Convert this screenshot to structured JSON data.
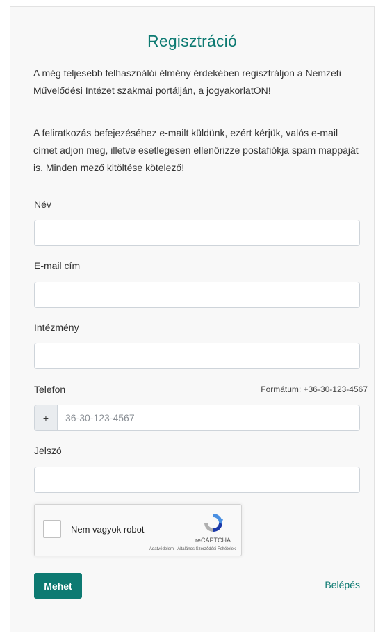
{
  "form": {
    "title": "Regisztráció",
    "intro": "A még teljesebb felhasználói élmény érdekében regisztráljon a Nemzeti Művelődési Intézet szakmai portálján, a jogyakorlatON!",
    "notice": "A feliratkozás befejezéséhez e-mailt küldünk, ezért kérjük, valós e-mail címet adjon meg, illetve esetlegesen ellenőrizze postafiókja spam mappáját is. Minden mező kitöltése kötelező!",
    "fields": {
      "name_label": "Név",
      "name_value": "",
      "email_label": "E-mail cím",
      "email_value": "",
      "institution_label": "Intézmény",
      "institution_value": "",
      "phone_label": "Telefon",
      "phone_hint": "Formátum: +36-30-123-4567",
      "phone_prefix": "+",
      "phone_placeholder": "36-30-123-4567",
      "password_label": "Jelszó",
      "password_value": ""
    },
    "captcha": {
      "label": "Nem vagyok robot",
      "brand": "reCAPTCHA",
      "links": "Adatvédelem - Általános Szerződési Feltételek",
      "checked": false
    },
    "submit_label": "Mehet",
    "login_label": "Belépés"
  },
  "colors": {
    "accent": "#0d7a72",
    "card_background": "#f8f8f8",
    "input_border": "#ced4da"
  }
}
